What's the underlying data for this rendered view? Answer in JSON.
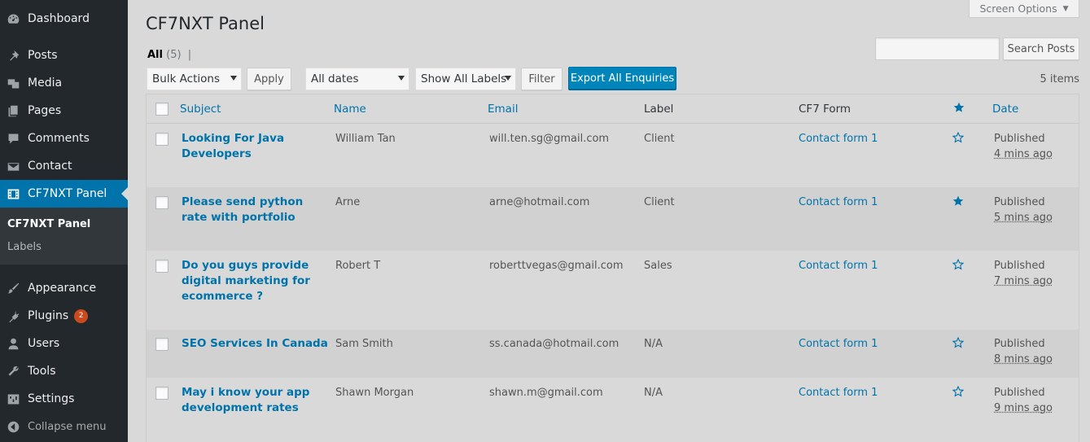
{
  "sidebar": {
    "items": [
      {
        "label": "Dashboard",
        "icon": "dashboard-icon"
      },
      {
        "label": "Posts",
        "icon": "pin-icon"
      },
      {
        "label": "Media",
        "icon": "media-icon"
      },
      {
        "label": "Pages",
        "icon": "pages-icon"
      },
      {
        "label": "Comments",
        "icon": "comment-icon"
      },
      {
        "label": "Contact",
        "icon": "envelope-icon"
      },
      {
        "label": "CF7NXT Panel",
        "icon": "film-icon"
      },
      {
        "label": "Appearance",
        "icon": "brush-icon"
      },
      {
        "label": "Plugins",
        "icon": "plug-icon",
        "badge": "2"
      },
      {
        "label": "Users",
        "icon": "user-icon"
      },
      {
        "label": "Tools",
        "icon": "wrench-icon"
      },
      {
        "label": "Settings",
        "icon": "settings-icon"
      },
      {
        "label": "Collapse menu",
        "icon": "collapse-icon"
      }
    ],
    "submenu": [
      "CF7NXT Panel",
      "Labels"
    ]
  },
  "header": {
    "title": "CF7NXT Panel",
    "screen_options": "Screen Options"
  },
  "views": {
    "all_label": "All",
    "all_count": "(5)",
    "separator": "|"
  },
  "search": {
    "button": "Search Posts",
    "value": ""
  },
  "toolbar": {
    "bulk_actions": "Bulk Actions",
    "apply": "Apply",
    "dates": "All dates",
    "labels": "Show All Labels",
    "filter": "Filter",
    "export": "Export All Enquiries",
    "item_count": "5 items"
  },
  "table": {
    "columns": {
      "subject": "Subject",
      "name": "Name",
      "email": "Email",
      "label": "Label",
      "form": "CF7 Form",
      "date": "Date"
    },
    "rows": [
      {
        "subject": "Looking For Java Developers",
        "name": "William Tan",
        "email": "will.ten.sg@gmail.com",
        "label": "Client",
        "form": "Contact form 1",
        "starred": false,
        "status": "Published",
        "ago": "4 mins ago"
      },
      {
        "subject": "Please send python rate with portfolio",
        "name": "Arne",
        "email": "arne@hotmail.com",
        "label": "Client",
        "form": "Contact form 1",
        "starred": true,
        "status": "Published",
        "ago": "5 mins ago"
      },
      {
        "subject": "Do you guys provide digital marketing for ecommerce ?",
        "name": "Robert T",
        "email": "roberttvegas@gmail.com",
        "label": "Sales",
        "form": "Contact form 1",
        "starred": false,
        "status": "Published",
        "ago": "7 mins ago"
      },
      {
        "subject": "SEO Services In Canada",
        "name": "Sam Smith",
        "email": "ss.canada@hotmail.com",
        "label": "N/A",
        "form": "Contact form 1",
        "starred": false,
        "status": "Published",
        "ago": "8 mins ago"
      },
      {
        "subject": "May i know your app development rates",
        "name": "Shawn Morgan",
        "email": "shawn.m@gmail.com",
        "label": "N/A",
        "form": "Contact form 1",
        "starred": false,
        "status": "Published",
        "ago": "9 mins ago"
      }
    ]
  },
  "colors": {
    "accent": "#0073aa",
    "sidebar": "#23282d",
    "primary_button": "#0085ba",
    "badge": "#ca4a1f"
  }
}
